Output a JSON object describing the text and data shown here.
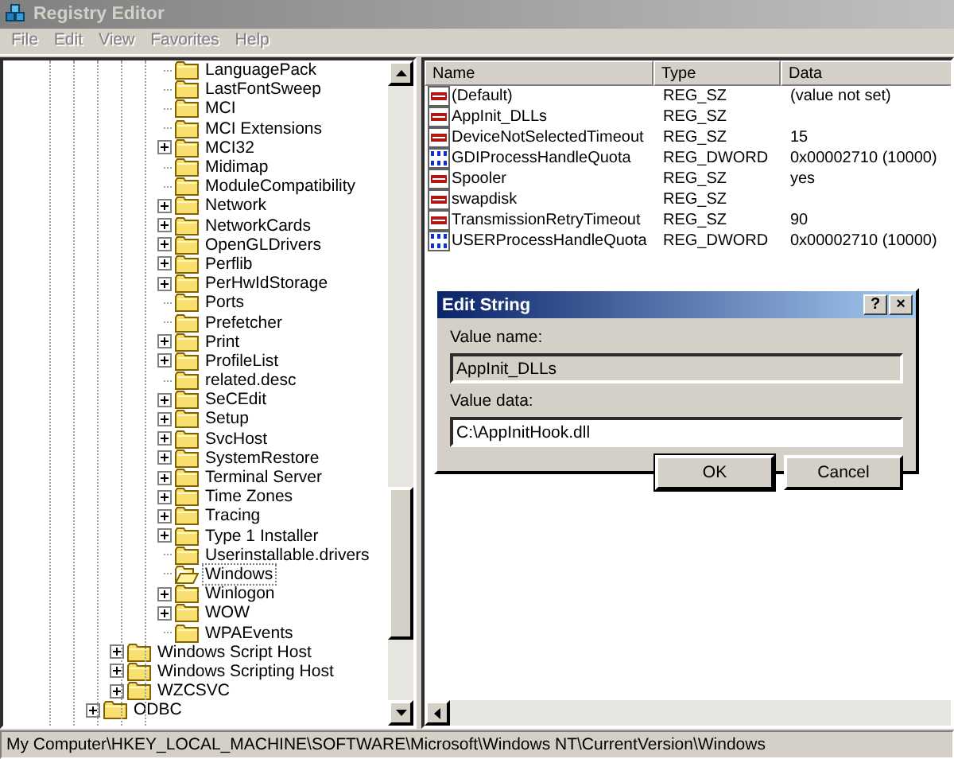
{
  "window": {
    "title": "Registry Editor"
  },
  "menu": {
    "disabled": true,
    "items": [
      "File",
      "Edit",
      "View",
      "Favorites",
      "Help"
    ]
  },
  "tree": {
    "items": [
      {
        "children": [
          {
            "children": [
              {
                "label": "LanguagePack",
                "expandable": false,
                "selected": false
              },
              {
                "label": "LastFontSweep",
                "expandable": false,
                "selected": false
              },
              {
                "label": "MCI",
                "expandable": false,
                "selected": false
              },
              {
                "label": "MCI Extensions",
                "expandable": false,
                "selected": false
              },
              {
                "label": "MCI32",
                "expandable": true,
                "selected": false
              },
              {
                "label": "Midimap",
                "expandable": false,
                "selected": false
              },
              {
                "label": "ModuleCompatibility",
                "expandable": false,
                "selected": false
              },
              {
                "label": "Network",
                "expandable": true,
                "selected": false
              },
              {
                "label": "NetworkCards",
                "expandable": true,
                "selected": false
              },
              {
                "label": "OpenGLDrivers",
                "expandable": true,
                "selected": false
              },
              {
                "label": "Perflib",
                "expandable": true,
                "selected": false
              },
              {
                "label": "PerHwIdStorage",
                "expandable": true,
                "selected": false
              },
              {
                "label": "Ports",
                "expandable": false,
                "selected": false
              },
              {
                "label": "Prefetcher",
                "expandable": false,
                "selected": false
              },
              {
                "label": "Print",
                "expandable": true,
                "selected": false
              },
              {
                "label": "ProfileList",
                "expandable": true,
                "selected": false
              },
              {
                "label": "related.desc",
                "expandable": false,
                "selected": false
              },
              {
                "label": "SeCEdit",
                "expandable": true,
                "selected": false
              },
              {
                "label": "Setup",
                "expandable": true,
                "selected": false
              },
              {
                "label": "SvcHost",
                "expandable": true,
                "selected": false
              },
              {
                "label": "SystemRestore",
                "expandable": true,
                "selected": false
              },
              {
                "label": "Terminal Server",
                "expandable": true,
                "selected": false
              },
              {
                "label": "Time Zones",
                "expandable": true,
                "selected": false
              },
              {
                "label": "Tracing",
                "expandable": true,
                "selected": false
              },
              {
                "label": "Type 1 Installer",
                "expandable": true,
                "selected": false
              },
              {
                "label": "Userinstallable.drivers",
                "expandable": false,
                "selected": false
              },
              {
                "label": "Windows",
                "expandable": false,
                "selected": true
              },
              {
                "label": "Winlogon",
                "expandable": true,
                "selected": false
              },
              {
                "label": "WOW",
                "expandable": true,
                "selected": false
              },
              {
                "label": "WPAEvents",
                "expandable": false,
                "selected": false
              }
            ]
          },
          {
            "label": "Windows Script Host",
            "expandable": true,
            "selected": false
          },
          {
            "label": "Windows Scripting Host",
            "expandable": true,
            "selected": false
          },
          {
            "label": "WZCSVC",
            "expandable": true,
            "selected": false
          }
        ]
      },
      {
        "label": "ODBC",
        "expandable": true,
        "selected": false
      }
    ]
  },
  "values": {
    "columns": [
      "Name",
      "Type",
      "Data"
    ],
    "rows": [
      {
        "kind": "sz",
        "name": "(Default)",
        "type": "REG_SZ",
        "data": "(value not set)"
      },
      {
        "kind": "sz",
        "name": "AppInit_DLLs",
        "type": "REG_SZ"
      },
      {
        "kind": "sz",
        "name": "DeviceNotSelectedTimeout",
        "type": "REG_SZ",
        "data": "15"
      },
      {
        "kind": "dword",
        "name": "GDIProcessHandleQuota",
        "type": "REG_DWORD",
        "data": "0x00002710 (10000)"
      },
      {
        "kind": "sz",
        "name": "Spooler",
        "type": "REG_SZ",
        "data": "yes"
      },
      {
        "kind": "sz",
        "name": "swapdisk",
        "type": "REG_SZ"
      },
      {
        "kind": "sz",
        "name": "TransmissionRetryTimeout",
        "type": "REG_SZ",
        "data": "90"
      },
      {
        "kind": "dword",
        "name": "USERProcessHandleQuota",
        "type": "REG_DWORD",
        "data": "0x00002710 (10000)"
      }
    ]
  },
  "dialog": {
    "title": "Edit String",
    "help_button": "?",
    "close_button": "×",
    "fields": [
      {
        "label": "Value name:",
        "value": "AppInit_DLLs",
        "disabled": true
      },
      {
        "label": "Value data:",
        "value": "C:\\AppInitHook.dll",
        "disabled": false
      }
    ],
    "buttons": [
      {
        "label": "OK",
        "default": true
      },
      {
        "label": "Cancel",
        "default": false
      }
    ]
  },
  "status_bar": "My Computer\\HKEY_LOCAL_MACHINE\\SOFTWARE\\Microsoft\\Windows NT\\CurrentVersion\\Windows"
}
